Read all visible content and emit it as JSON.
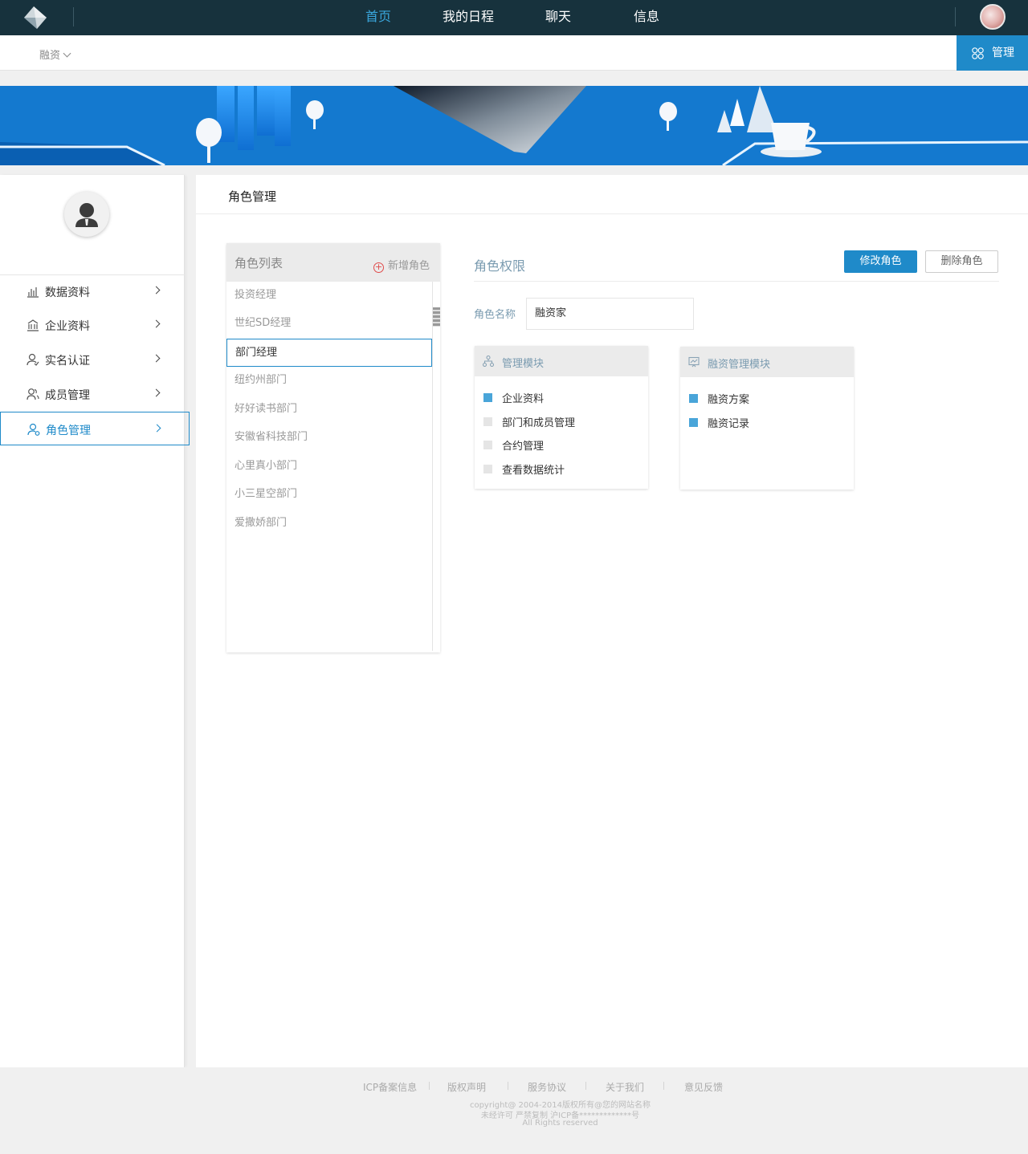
{
  "nav": {
    "items": [
      "首页",
      "我的日程",
      "聊天",
      "信息"
    ],
    "active_index": 0
  },
  "subbar": {
    "select_value": "融资",
    "manage_label": "管理"
  },
  "sidebar": {
    "items": [
      {
        "label": "数据资料",
        "icon": "bar-chart-icon"
      },
      {
        "label": "企业资料",
        "icon": "building-icon"
      },
      {
        "label": "实名认证",
        "icon": "user-verify-icon"
      },
      {
        "label": "成员管理",
        "icon": "members-icon"
      },
      {
        "label": "角色管理",
        "icon": "role-icon"
      }
    ],
    "active_index": 4
  },
  "main": {
    "title": "角色管理"
  },
  "role_list": {
    "title": "角色列表",
    "add_label": "新增角色",
    "items": [
      "投资经理",
      "世纪SD经理",
      "部门经理",
      "纽约州部门",
      "好好读书部门",
      "安徽省科技部门",
      "心里真小部门",
      "小三星空部门",
      "爱撒娇部门"
    ],
    "selected_index": 2
  },
  "permissions": {
    "title": "角色权限",
    "edit_button": "修改角色",
    "delete_button": "删除角色",
    "role_name_label": "角色名称",
    "role_name_value": "融资家",
    "modules": [
      {
        "title": "管理模块",
        "icon": "org-tree-icon",
        "items": [
          {
            "label": "企业资料",
            "checked": true
          },
          {
            "label": "部门和成员管理",
            "checked": false
          },
          {
            "label": "合约管理",
            "checked": false
          },
          {
            "label": "查看数据统计",
            "checked": false
          }
        ]
      },
      {
        "title": "融资管理模块",
        "icon": "chart-board-icon",
        "items": [
          {
            "label": "融资方案",
            "checked": true
          },
          {
            "label": "融资记录",
            "checked": true
          }
        ]
      }
    ]
  },
  "footer": {
    "links": [
      "ICP备案信息",
      "版权声明",
      "服务协议",
      "关于我们",
      "意见反馈"
    ],
    "copyright_lines": [
      "copyright@ 2004-2014版权所有@您的网站名称",
      "未经许可 严禁复制 沪ICP备*************号",
      "All Rights reserved"
    ]
  },
  "colors": {
    "topbar": "#17323d",
    "accent": "#1f8ac9",
    "active_nav": "#3aa7dd",
    "checkbox_on": "#49a5d9",
    "checkbox_off": "#e5e5e5"
  }
}
